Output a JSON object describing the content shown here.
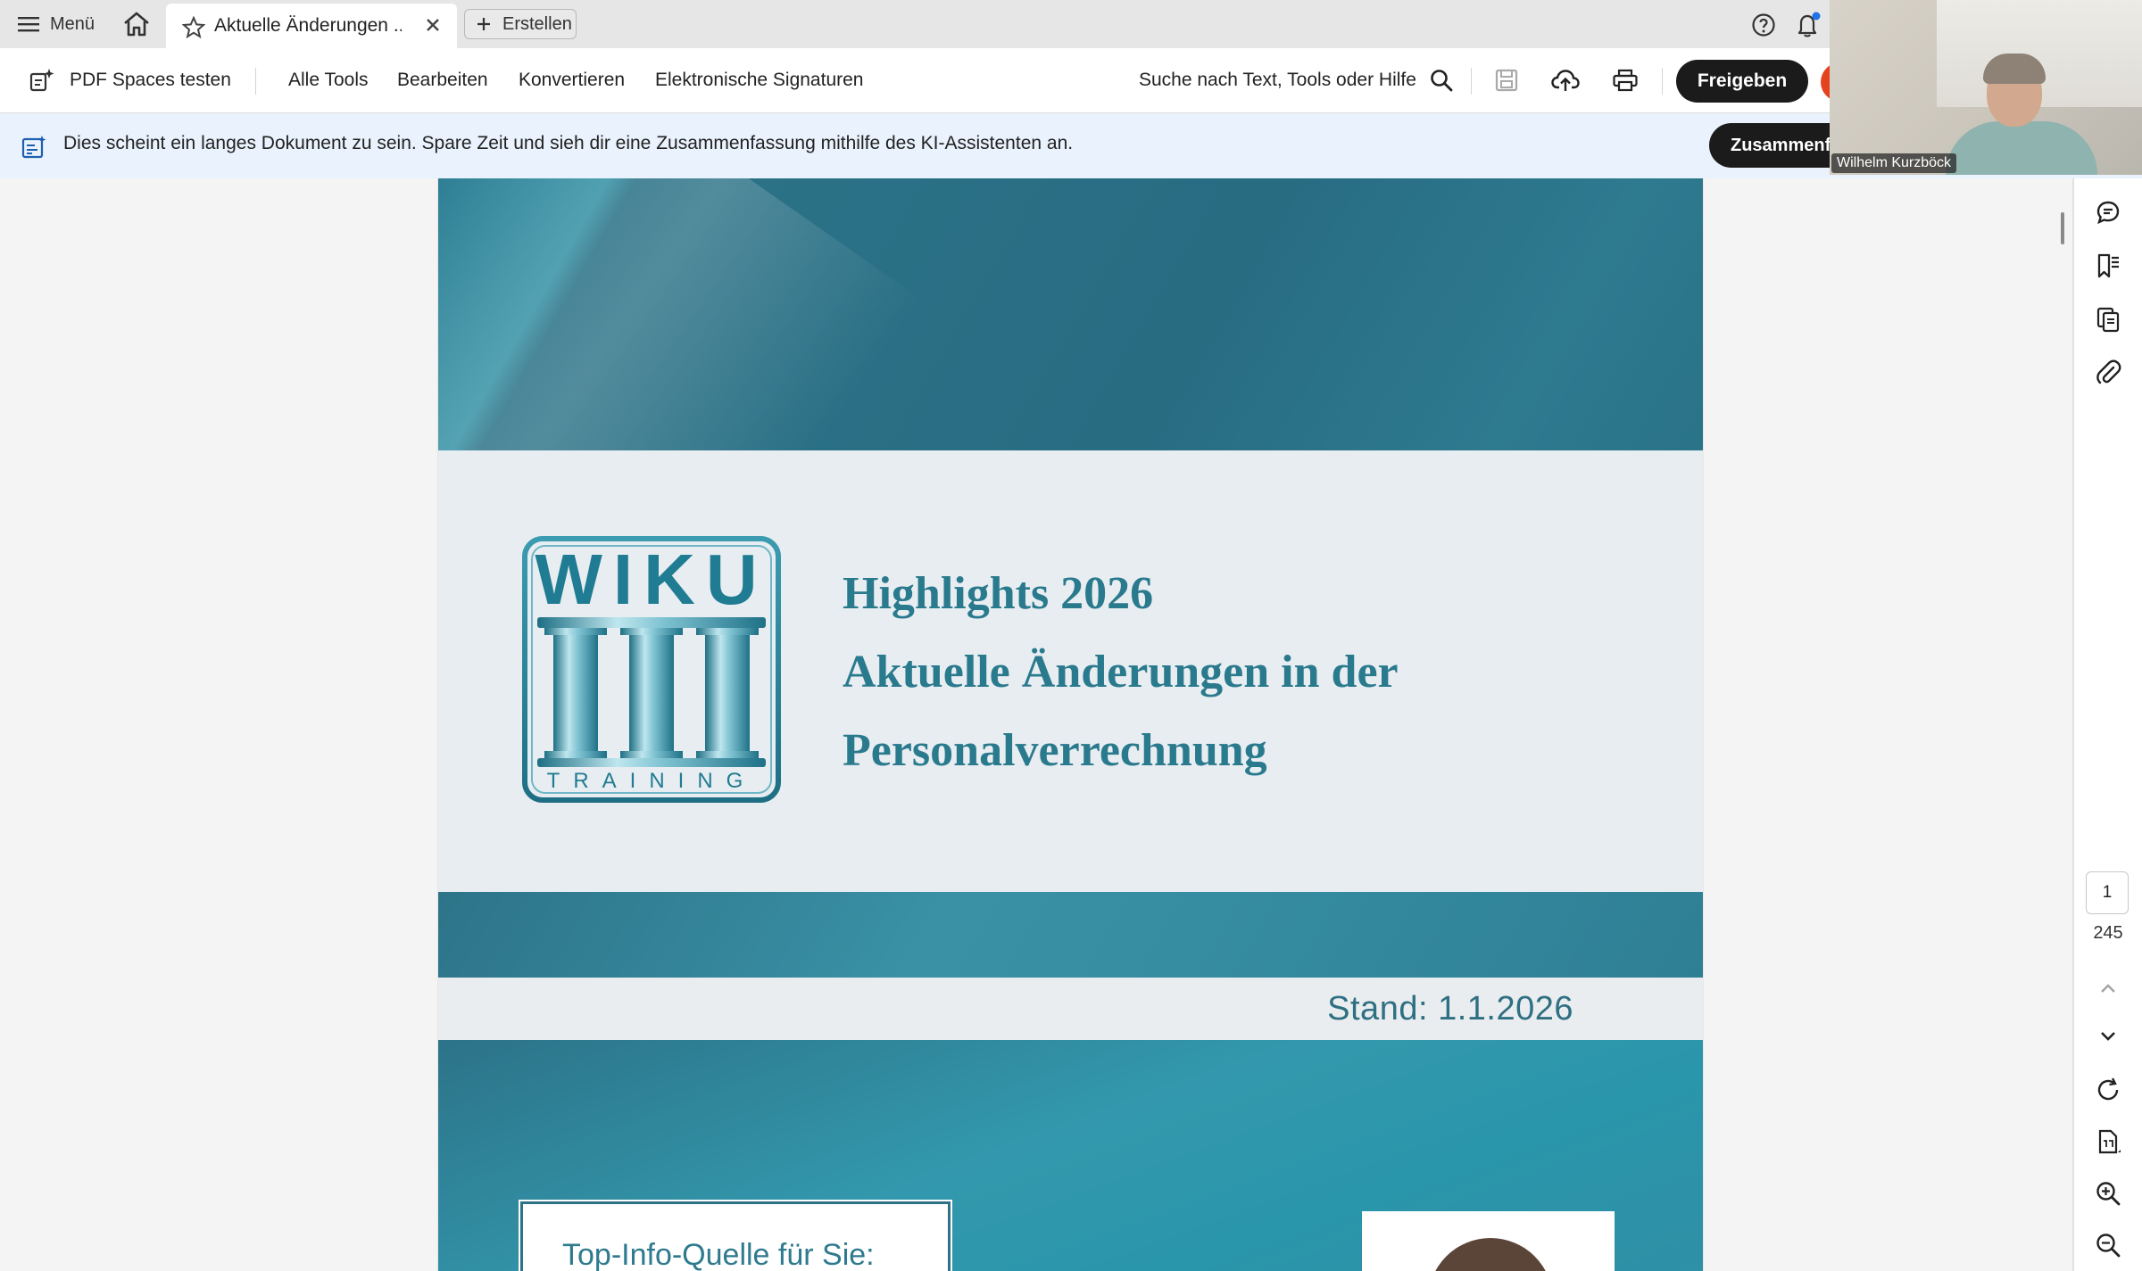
{
  "tabbar": {
    "menu_label": "Menü",
    "tab_title": "Aktuelle Änderungen ...",
    "new_label": "Erstellen"
  },
  "toolbar": {
    "spaces_label": "PDF Spaces testen",
    "all_tools": "Alle Tools",
    "edit": "Bearbeiten",
    "convert": "Konvertieren",
    "esign": "Elektronische Signaturen",
    "search_label": "Suche nach Text, Tools oder Hilfe",
    "share_label": "Freigeben"
  },
  "banner": {
    "text": "Dies scheint ein langes Dokument zu sein. Spare Zeit und sieh dir eine Zusammenfassung mithilfe des KI-Assistenten an.",
    "button_label": "Zusammenf"
  },
  "webcam": {
    "participant_name": "Wilhelm Kurzböck"
  },
  "document": {
    "logo_top": "WIKU",
    "logo_bottom": "TRAINING",
    "headline": [
      "Highlights 2026",
      "Aktuelle Änderungen in der",
      "Personalverrechnung"
    ],
    "stand": "Stand: 1.1.2026",
    "info_box": "Top-Info-Quelle für Sie:",
    "colors": {
      "teal_dark": "#2c7388",
      "teal_text": "#2a7a8e",
      "page_bg": "#eaedf0"
    }
  },
  "navigator": {
    "current_page": "1",
    "total_pages": "245"
  },
  "tools": [
    "select-icon",
    "comment-icon",
    "highlight-pen-icon",
    "lasso-draw-icon",
    "text-recognition-icon",
    "sign-pen-icon",
    "more-icon"
  ],
  "side_icons": [
    "comments-icon",
    "bookmarks-icon",
    "pages-icon",
    "attachments-icon",
    "rotate-icon",
    "page-fit-icon",
    "zoom-in-icon",
    "zoom-out-icon"
  ]
}
